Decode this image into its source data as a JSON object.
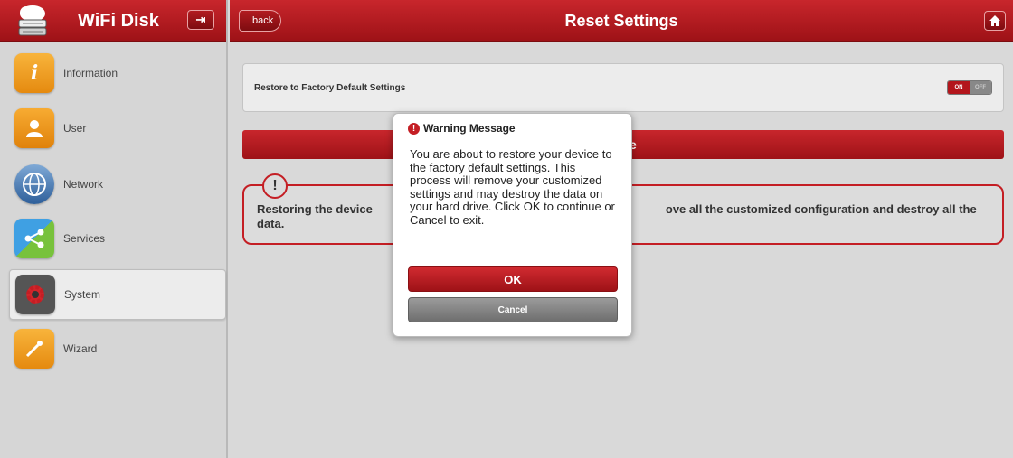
{
  "app": {
    "title": "WiFi Disk",
    "logo_icon": "cloud-disk-icon",
    "logout_icon": "logout-icon"
  },
  "sidebar": {
    "items": [
      {
        "label": "Information",
        "icon": "info-icon",
        "active": false
      },
      {
        "label": "User",
        "icon": "user-icon",
        "active": false
      },
      {
        "label": "Network",
        "icon": "globe-icon",
        "active": false
      },
      {
        "label": "Services",
        "icon": "share-icon",
        "active": false
      },
      {
        "label": "System",
        "icon": "gear-icon",
        "active": true
      },
      {
        "label": "Wizard",
        "icon": "wand-icon",
        "active": false
      }
    ]
  },
  "topbar": {
    "back_label": "back",
    "title": "Reset Settings",
    "home_icon": "home-icon"
  },
  "content": {
    "setting_label": "Restore to Factory Default Settings",
    "toggle_on": "ON",
    "toggle_off": "OFF",
    "restore_bar_label": "e",
    "warning_badge": "!",
    "warning_text_start": "Restoring the device",
    "warning_text_end": "ove all the customized configuration and destroy all the data."
  },
  "modal": {
    "title": "Warning Message",
    "alert_glyph": "!",
    "message": "You are about to restore your device to the factory default settings. This process will remove your customized settings and may destroy the data on your hard drive. Click OK to continue or Cancel to exit.",
    "ok_label": "OK",
    "cancel_label": "Cancel"
  },
  "colors": {
    "brand_red": "#b3161c",
    "sidebar_bg": "#d6d6d6",
    "content_bg": "#d9d9d9"
  }
}
